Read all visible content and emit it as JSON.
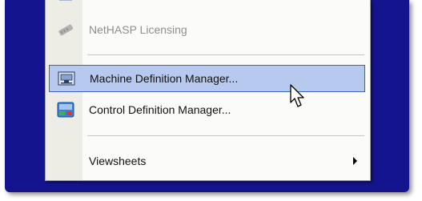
{
  "menu": {
    "items": [
      {
        "label": "NetHASP Licensing",
        "icon": "license-key-icon",
        "disabled": true
      },
      {
        "label": "Machine Definition Manager...",
        "icon": "machine-definition-icon",
        "highlighted": true
      },
      {
        "label": "Control Definition Manager...",
        "icon": "control-definition-icon"
      },
      {
        "label": "Viewsheets",
        "icon": "none",
        "has_submenu": true
      }
    ]
  },
  "colors": {
    "desktop": "#14148f",
    "highlight_fill": "#b8c9ef",
    "highlight_border": "#3d63c2"
  }
}
